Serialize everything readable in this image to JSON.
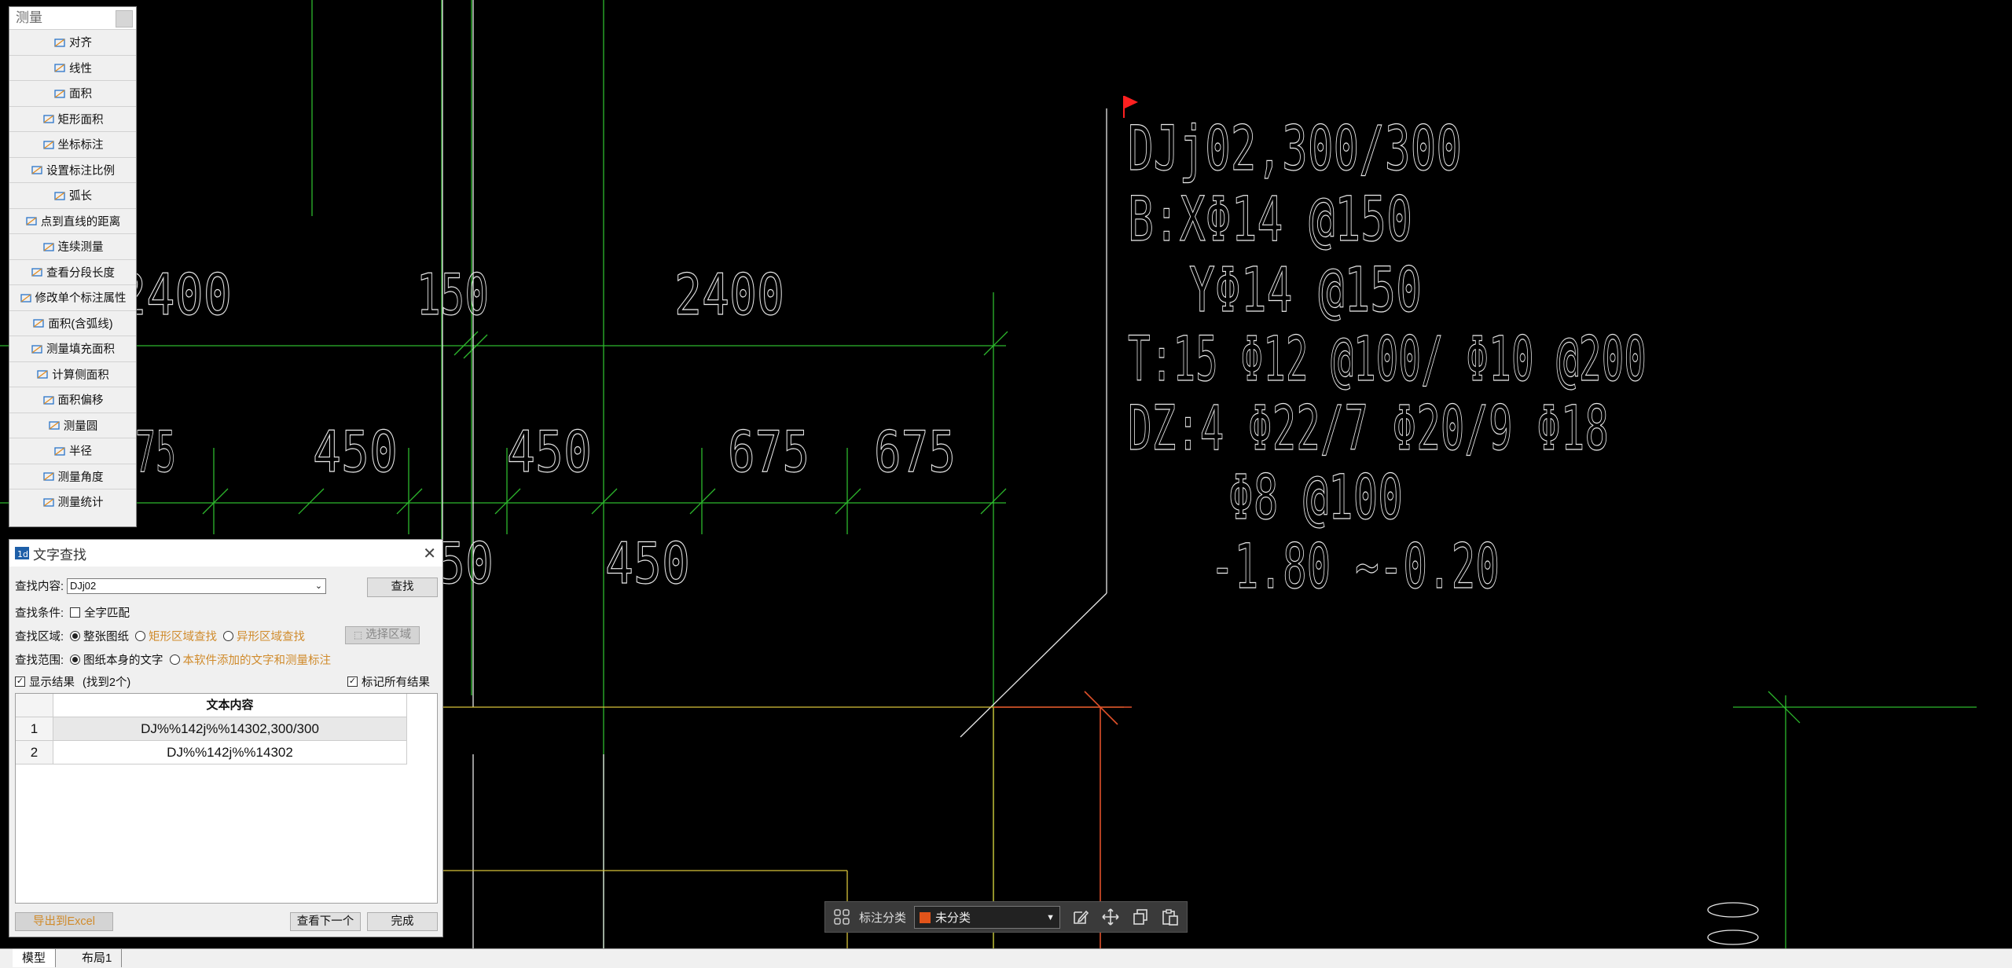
{
  "measure_panel": {
    "title": "测量",
    "items": [
      "对齐",
      "线性",
      "面积",
      "矩形面积",
      "坐标标注",
      "设置标注比例",
      "弧长",
      "点到直线的距离",
      "连续测量",
      "查看分段长度",
      "修改单个标注属性",
      "面积(含弧线)",
      "测量填充面积",
      "计算侧面积",
      "面积偏移",
      "测量圆",
      "半径",
      "测量角度",
      "测量统计"
    ]
  },
  "find_dialog": {
    "title": "文字查找",
    "content_label": "查找内容:",
    "content_value": "DJj02",
    "find_button": "查找",
    "condition_label": "查找条件:",
    "whole_word": "全字匹配",
    "area_label": "查找区域:",
    "area_options": [
      "整张图纸",
      "矩形区域查找",
      "异形区域查找"
    ],
    "select_area_button": "选择区域",
    "scope_label": "查找范围:",
    "scope_options": [
      "图纸本身的文字",
      "本软件添加的文字和测量标注"
    ],
    "show_results": "显示结果",
    "found": "(找到2个)",
    "mark_all": "标记所有结果",
    "column_header": "文本内容",
    "results": [
      {
        "index": "1",
        "text": "DJ%%142j%%14302,300/300"
      },
      {
        "index": "2",
        "text": "DJ%%142j%%14302"
      }
    ],
    "export_button": "导出到Excel",
    "next_button": "查看下一个",
    "done_button": "完成"
  },
  "annot_bar": {
    "label": "标注分类",
    "selected": "未分类",
    "swatch_color": "#e2541a"
  },
  "tabs": [
    "模型",
    "布局1"
  ],
  "cad": {
    "annotation_lines": [
      "DJj02,300/300",
      "B:XΦ14 @150",
      "YΦ14 @150",
      "T:15 Φ12 @100/ Φ10 @200",
      "DZ:4 Φ22/7 Φ20/9 Φ18",
      "Φ8 @100",
      "-1.80 ~-0.20"
    ],
    "dims_top": [
      "2400",
      "150",
      "2400"
    ],
    "dims_mid": [
      "75",
      "450",
      "450",
      "675",
      "675"
    ],
    "dims_low": [
      "450",
      "450",
      "450"
    ],
    "colors": {
      "grid": "#2db82d",
      "text": "#ffffff",
      "wall": "#d8c23a",
      "accent": "#e0512a"
    }
  }
}
